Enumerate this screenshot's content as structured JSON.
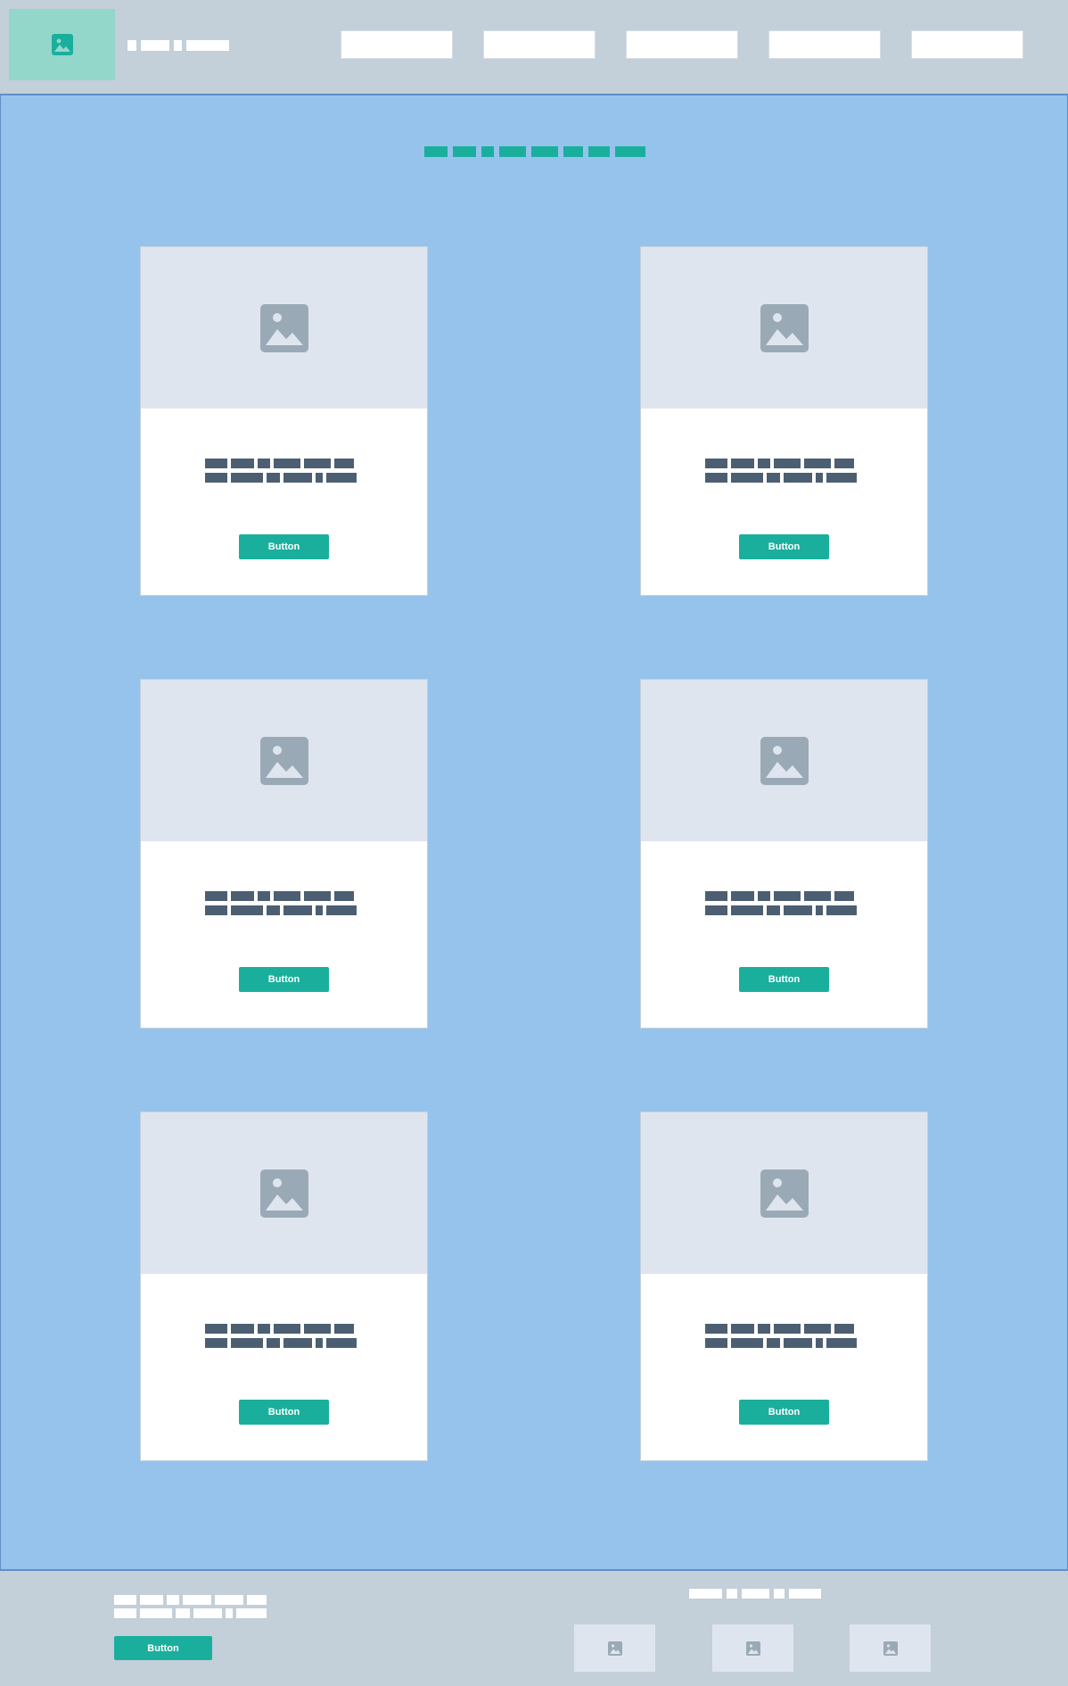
{
  "header": {
    "logo_icon": "image-icon",
    "nav_items": [
      "",
      "",
      "",
      "",
      ""
    ]
  },
  "cards": [
    {
      "image_icon": "image-icon",
      "button_label": "Button"
    },
    {
      "image_icon": "image-icon",
      "button_label": "Button"
    },
    {
      "image_icon": "image-icon",
      "button_label": "Button"
    },
    {
      "image_icon": "image-icon",
      "button_label": "Button"
    },
    {
      "image_icon": "image-icon",
      "button_label": "Button"
    },
    {
      "image_icon": "image-icon",
      "button_label": "Button"
    }
  ],
  "footer": {
    "button_label": "Button",
    "thumbnails": [
      "image-icon",
      "image-icon",
      "image-icon"
    ]
  },
  "colors": {
    "accent": "#1aaf9d",
    "page_background": "#96c3ec",
    "header_background": "#c3cfd9",
    "placeholder_text": "#4c5f72",
    "image_placeholder": "#dfe5ee"
  }
}
